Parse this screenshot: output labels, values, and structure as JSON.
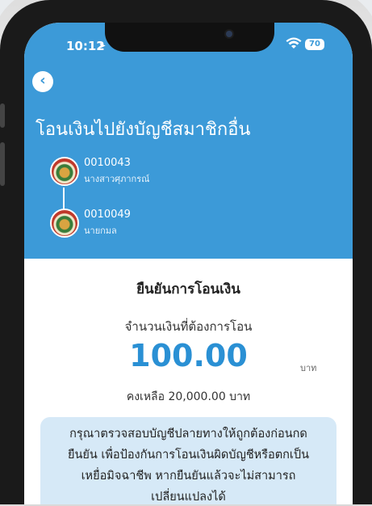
{
  "status_bar": {
    "time": "10:12",
    "battery": "70"
  },
  "header": {
    "title": "โอนเงินไปยังบัญชีสมาชิกอื่น"
  },
  "from_account": {
    "number": "0010043",
    "name": "นางสาวศุภากรณ์"
  },
  "to_account": {
    "number": "0010049",
    "name": "นายกมล"
  },
  "confirm": {
    "title": "ยืนยันการโอนเงิน",
    "amount_label": "จำนวนเงินที่ต้องการโอน",
    "amount": "100.00",
    "unit": "บาท",
    "balance": "คงเหลือ 20,000.00 บาท"
  },
  "warning": {
    "lines": [
      "กรุณาตรวจสอบบัญชีปลายทางให้ถูกต้องก่อนกด",
      "ยืนยัน เพื่อป้องกันการโอนเงินผิดบัญชีหรือตกเป็น",
      "เหยื่อมิจฉาชีพ หากยืนยันแล้วจะไม่สามารถ",
      "เปลี่ยนแปลงได้"
    ]
  },
  "colors": {
    "header_bg": "#3c9ad8",
    "amount": "#2a90d4",
    "warning_bg": "#d6e9f7"
  },
  "icons": {
    "back": "chevron-left-icon",
    "wifi": "wifi-icon",
    "battery": "battery-icon",
    "location": "location-arrow-icon"
  }
}
